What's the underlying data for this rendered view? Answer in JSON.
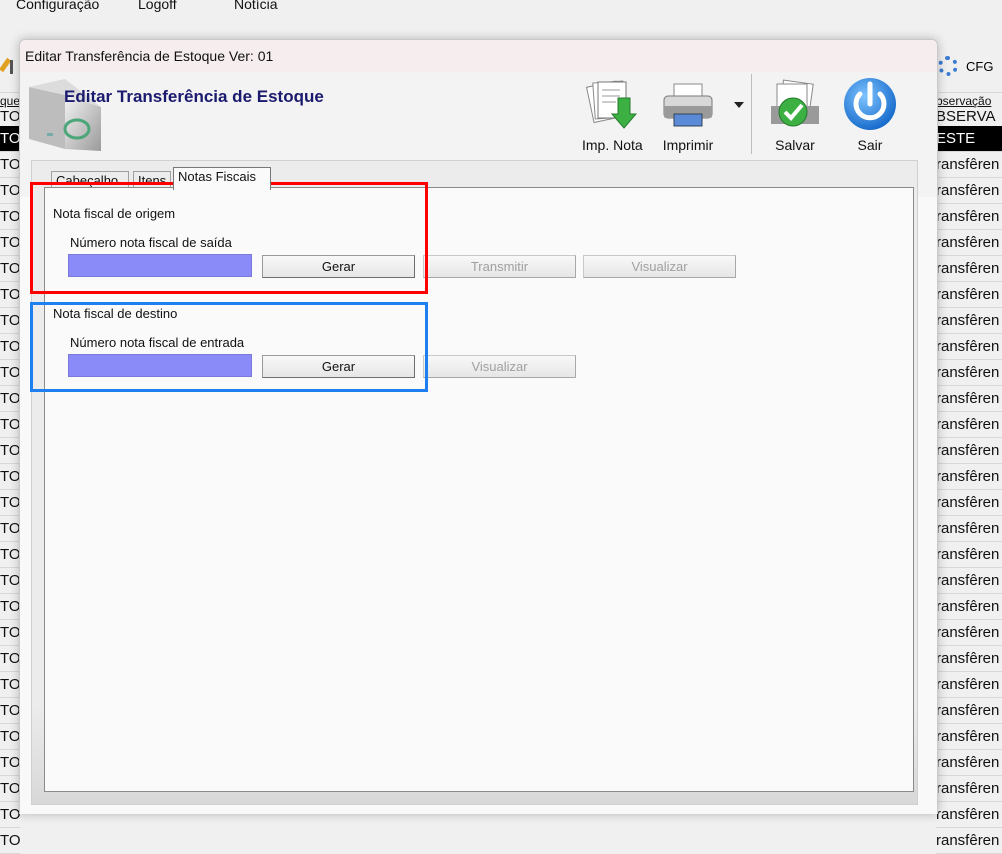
{
  "background": {
    "menu": [
      "Configuração",
      "Logoff",
      "Notícia"
    ],
    "cfg_label": "CFG",
    "left_header": "que",
    "left_sub": "TO",
    "left_selected": "TO",
    "left_rows": [
      "TO",
      "TO",
      "TO",
      "TO",
      "TO",
      "TO",
      "TO",
      "TO",
      "TO",
      "TO",
      "TO",
      "TO",
      "TO",
      "TO",
      "TO",
      "TO",
      "TO",
      "TO",
      "TO",
      "TO",
      "TO",
      "TO",
      "TO",
      "TO",
      "TO",
      "TO",
      "TO"
    ],
    "right_header": "bservação",
    "right_sub": "BSERVA",
    "right_selected": "ESTE",
    "right_rows": [
      "ransfêren",
      "ransfêren",
      "ransfêren",
      "ransfêren",
      "ransfêren",
      "ransfêren",
      "ransfêren",
      "ransfêren",
      "ransfêren",
      "ransfêren",
      "ransfêren",
      "ransfêren",
      "ransfêren",
      "ransfêren",
      "ransfêren",
      "ransfêren",
      "ransfêren",
      "ransfêren",
      "ransfêren",
      "ransfêren",
      "ransfêren",
      "ransfêren",
      "ransfêren",
      "ransfêren",
      "ransfêren",
      "ransfêren",
      "ransfêren"
    ]
  },
  "dialog": {
    "window_title": "Editar Transferência de Estoque Ver: 01",
    "heading": "Editar Transferência de Estoque",
    "toolbar": {
      "imp_nota": "Imp. Nota",
      "imprimir": "Imprimir",
      "salvar": "Salvar",
      "sair": "Sair"
    },
    "tabs": [
      "Cabeçalho",
      "Itens",
      "Notas Fiscais"
    ],
    "active_tab": "Notas Fiscais",
    "origem": {
      "section_title": "Nota fiscal de origem",
      "field_label": "Número nota fiscal de saída",
      "field_value": "",
      "gerar": "Gerar",
      "transmitir": "Transmitir",
      "visualizar": "Visualizar"
    },
    "destino": {
      "section_title": "Nota fiscal de destino",
      "field_label": "Número nota fiscal de entrada",
      "field_value": "",
      "gerar": "Gerar",
      "visualizar": "Visualizar"
    }
  },
  "colors": {
    "field_fill": "#8a8af8",
    "heading": "#1a1a6e",
    "highlight_red": "#ff0000",
    "highlight_blue": "#1e7ff0"
  }
}
